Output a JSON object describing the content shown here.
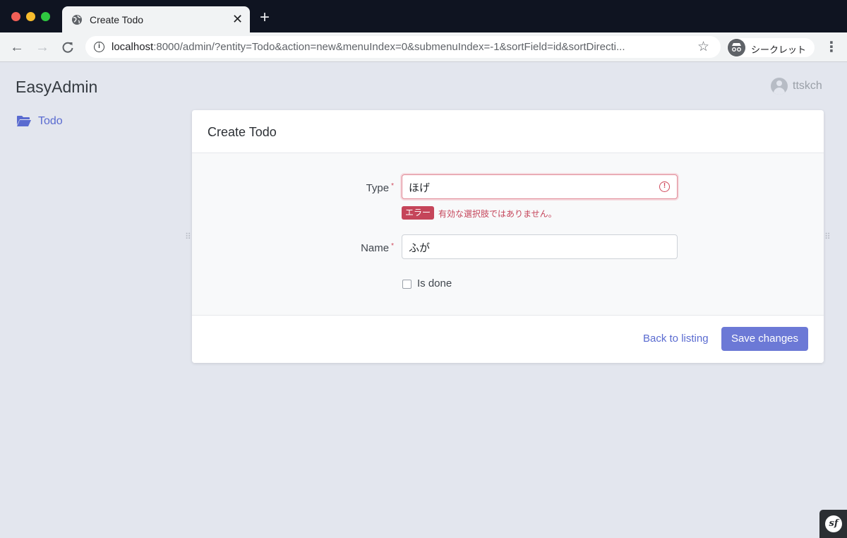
{
  "browser": {
    "tab_title": "Create Todo",
    "tab_close": "✕",
    "new_tab": "+",
    "url_host": "localhost",
    "url_rest": ":8000/admin/?entity=Todo&action=new&menuIndex=0&submenuIndex=-1&sortField=id&sortDirecti...",
    "incognito_label": "シークレット",
    "colors": {
      "tabbar": "#0f1421",
      "toolbar": "#f1f3f4"
    }
  },
  "app": {
    "brand": "EasyAdmin",
    "user_name": "ttskch",
    "menu": [
      {
        "label": "Todo",
        "icon": "folder-open-icon"
      }
    ],
    "accent_color": "#5a6bd0"
  },
  "form": {
    "title": "Create Todo",
    "fields": {
      "type": {
        "label": "Type",
        "required_mark": "*",
        "value": "ほげ",
        "error_badge": "エラー",
        "error_message": "有効な選択肢ではありません。"
      },
      "name": {
        "label": "Name",
        "required_mark": "*",
        "value": "ふが"
      },
      "is_done": {
        "label": "Is done",
        "checked": false
      }
    },
    "actions": {
      "back": "Back to listing",
      "save": "Save changes"
    }
  },
  "footer_logo": "sf"
}
